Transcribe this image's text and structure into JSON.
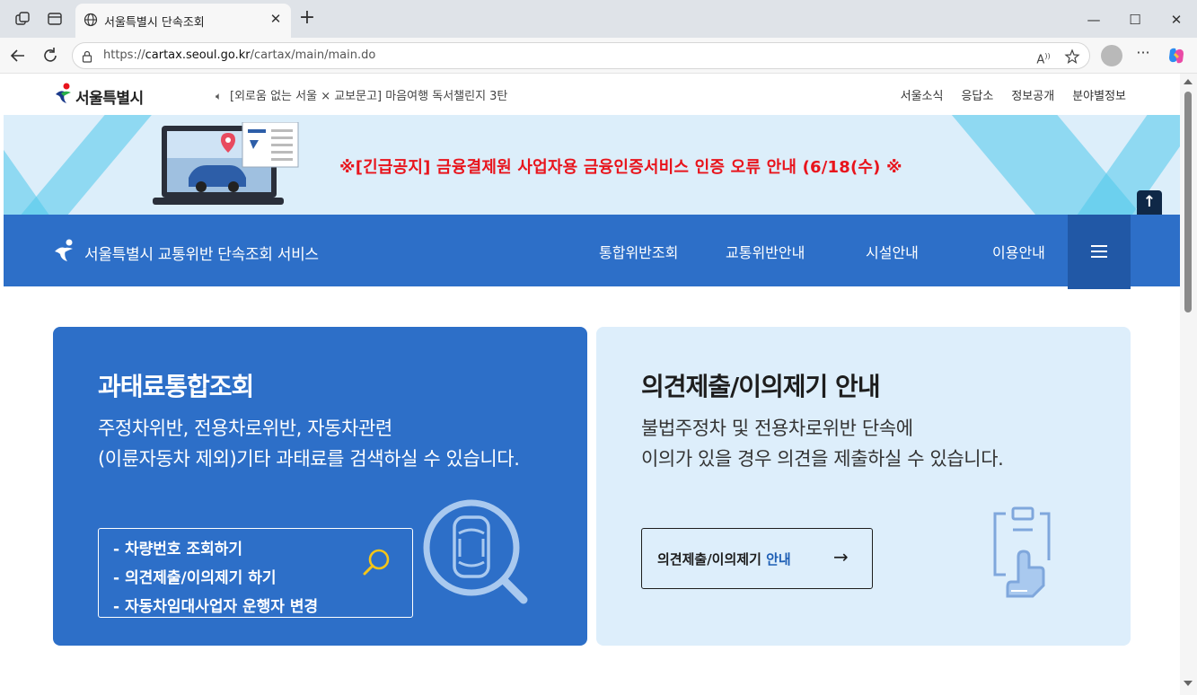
{
  "browser": {
    "tab_title": "서울특별시 단속조회",
    "url_host": "cartax.seoul.go.kr",
    "url_prefix": "https://",
    "url_path": "/cartax/main/main.do"
  },
  "site": {
    "logo_text": "서울특별시",
    "ticker": "[외로움 없는 서울 × 교보문고] 마음여행 독서챌린지 3탄",
    "top_links": [
      "서울소식",
      "응답소",
      "정보공개",
      "분야별정보"
    ]
  },
  "banner": {
    "notice": "※[긴급공지] 금융결제원 사업자용 금융인증서비스 인증 오류 안내 (6/18(수) ※"
  },
  "navbar": {
    "brand": "서울특별시 교통위반 단속조회 서비스",
    "menu": [
      "통합위반조회",
      "교통위반안내",
      "시설안내",
      "이용안내"
    ]
  },
  "card_left": {
    "title": "과태료통합조회",
    "desc_line1": "주정차위반, 전용차로위반, 자동차관련",
    "desc_line2": "(이륜자동차 제외)기타 과태료를 검색하실 수 있습니다.",
    "links": [
      "- 차량번호 조회하기",
      "- 의견제출/이의제기 하기",
      "- 자동차임대사업자 운행자 변경"
    ]
  },
  "card_right": {
    "title": "의견제출/이의제기 안내",
    "desc_line1": "불법주정차 및 전용차로위반 단속에",
    "desc_line2": "이의가 있을 경우 의견을 제출하실 수 있습니다.",
    "button_main": "의견제출/이의제기",
    "button_accent": "안내",
    "button_arrow": "→"
  },
  "colors": {
    "primary_blue": "#2d6fc8",
    "dark_blue": "#2158a6",
    "notice_red": "#e8141c",
    "card_light": "#ddeefb"
  },
  "icons": [
    "globe-icon",
    "search-icon",
    "car-icon",
    "clipboard-hand-icon",
    "speaker-icon",
    "lock-icon",
    "star-icon",
    "read-aloud-icon",
    "copilot-icon"
  ]
}
